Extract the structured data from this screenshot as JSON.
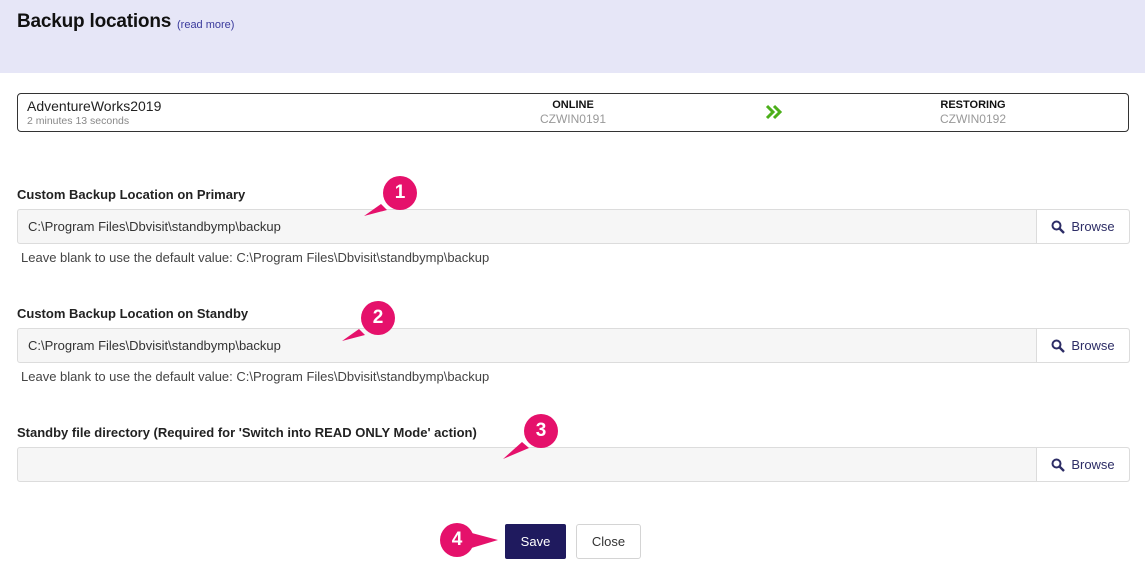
{
  "header": {
    "title": "Backup locations",
    "read_more": "(read more)"
  },
  "database": {
    "name": "AdventureWorks2019",
    "elapsed": "2 minutes 13 seconds",
    "primary": {
      "status": "ONLINE",
      "host": "CZWIN0191"
    },
    "standby": {
      "status": "RESTORING",
      "host": "CZWIN0192"
    }
  },
  "fields": [
    {
      "label": "Custom Backup Location on Primary",
      "value": "C:\\Program Files\\Dbvisit\\standbymp\\backup",
      "help": "Leave blank to use the default value: C:\\Program Files\\Dbvisit\\standbymp\\backup",
      "browse": "Browse"
    },
    {
      "label": "Custom Backup Location on Standby",
      "value": "C:\\Program Files\\Dbvisit\\standbymp\\backup",
      "help": "Leave blank to use the default value: C:\\Program Files\\Dbvisit\\standbymp\\backup",
      "browse": "Browse"
    },
    {
      "label": "Standby file directory (Required for 'Switch into READ ONLY Mode' action)",
      "value": "",
      "browse": "Browse"
    }
  ],
  "callouts": [
    "1",
    "2",
    "3",
    "4"
  ],
  "actions": {
    "save": "Save",
    "close": "Close"
  },
  "colors": {
    "header_bg": "#e6e6f7",
    "accent": "#1f1a5e",
    "callout": "#e5116b",
    "arrow": "#4caf1a"
  },
  "icons": {
    "browse": "search-icon",
    "status_arrow": "double-chevron-right-icon"
  }
}
